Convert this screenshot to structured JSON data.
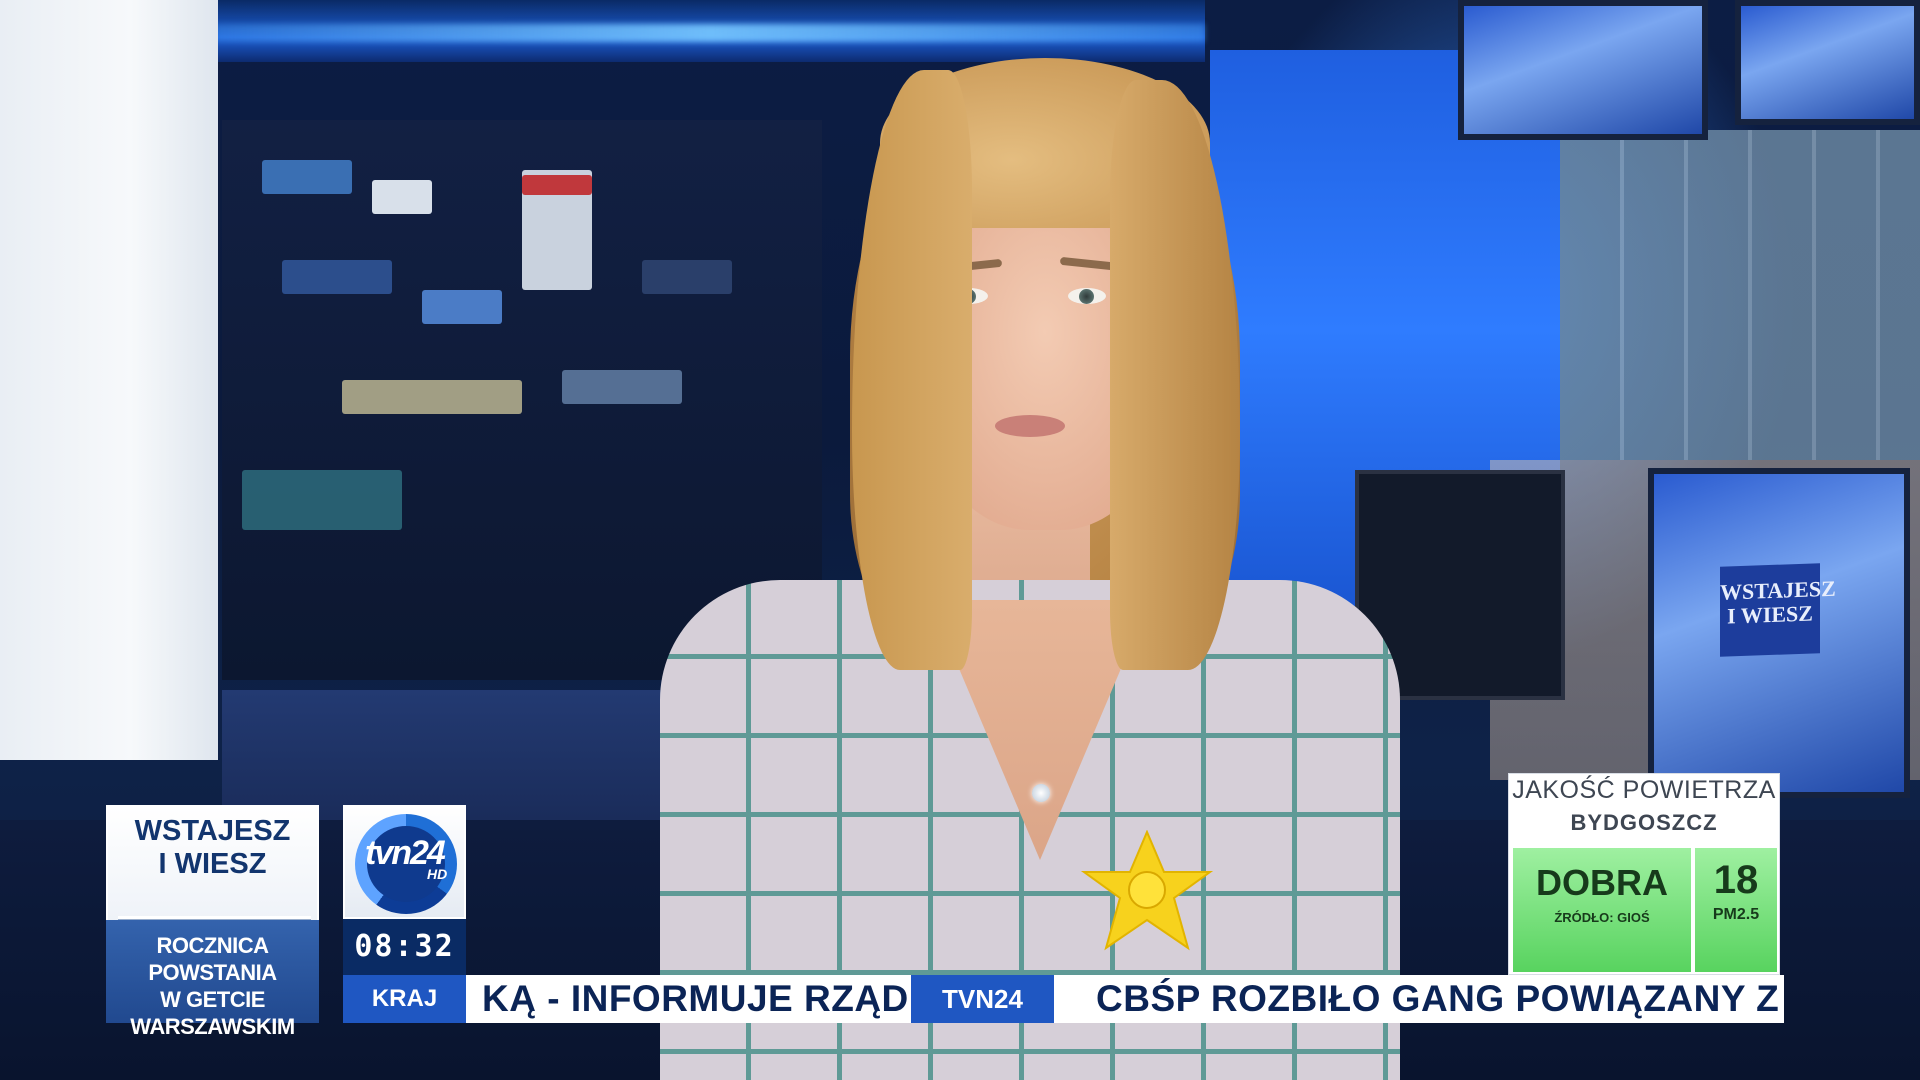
{
  "program": {
    "title_line1": "WSTAJESZ",
    "title_line2": "I WIESZ",
    "topic_line1": "ROCZNICA POWSTANIA",
    "topic_line2": "W GETCIE WARSZAWSKIM"
  },
  "channel": {
    "logo_text": "tvn24",
    "logo_hd": "HD",
    "clock": "08:32",
    "section": "KRAJ"
  },
  "ticker": {
    "left_text": "KĄ - INFORMUJE RZĄD",
    "channel_label": "TVN24",
    "right_text": "CBŚP ROZBIŁO GANG POWIĄZANY Z"
  },
  "air_quality": {
    "title": "JAKOŚĆ POWIETRZA",
    "city": "BYDGOSZCZ",
    "rating": "DOBRA",
    "source": "ŹRÓDŁO: GIOŚ",
    "value": "18",
    "unit": "PM2.5",
    "color": "#58d35f"
  },
  "studio": {
    "monitor_label_line1": "WSTAJESZ",
    "monitor_label_line2": "I WIESZ"
  },
  "colors": {
    "brand_blue": "#1f57c2",
    "navy": "#0a2b64",
    "text_navy": "#0b2456"
  }
}
